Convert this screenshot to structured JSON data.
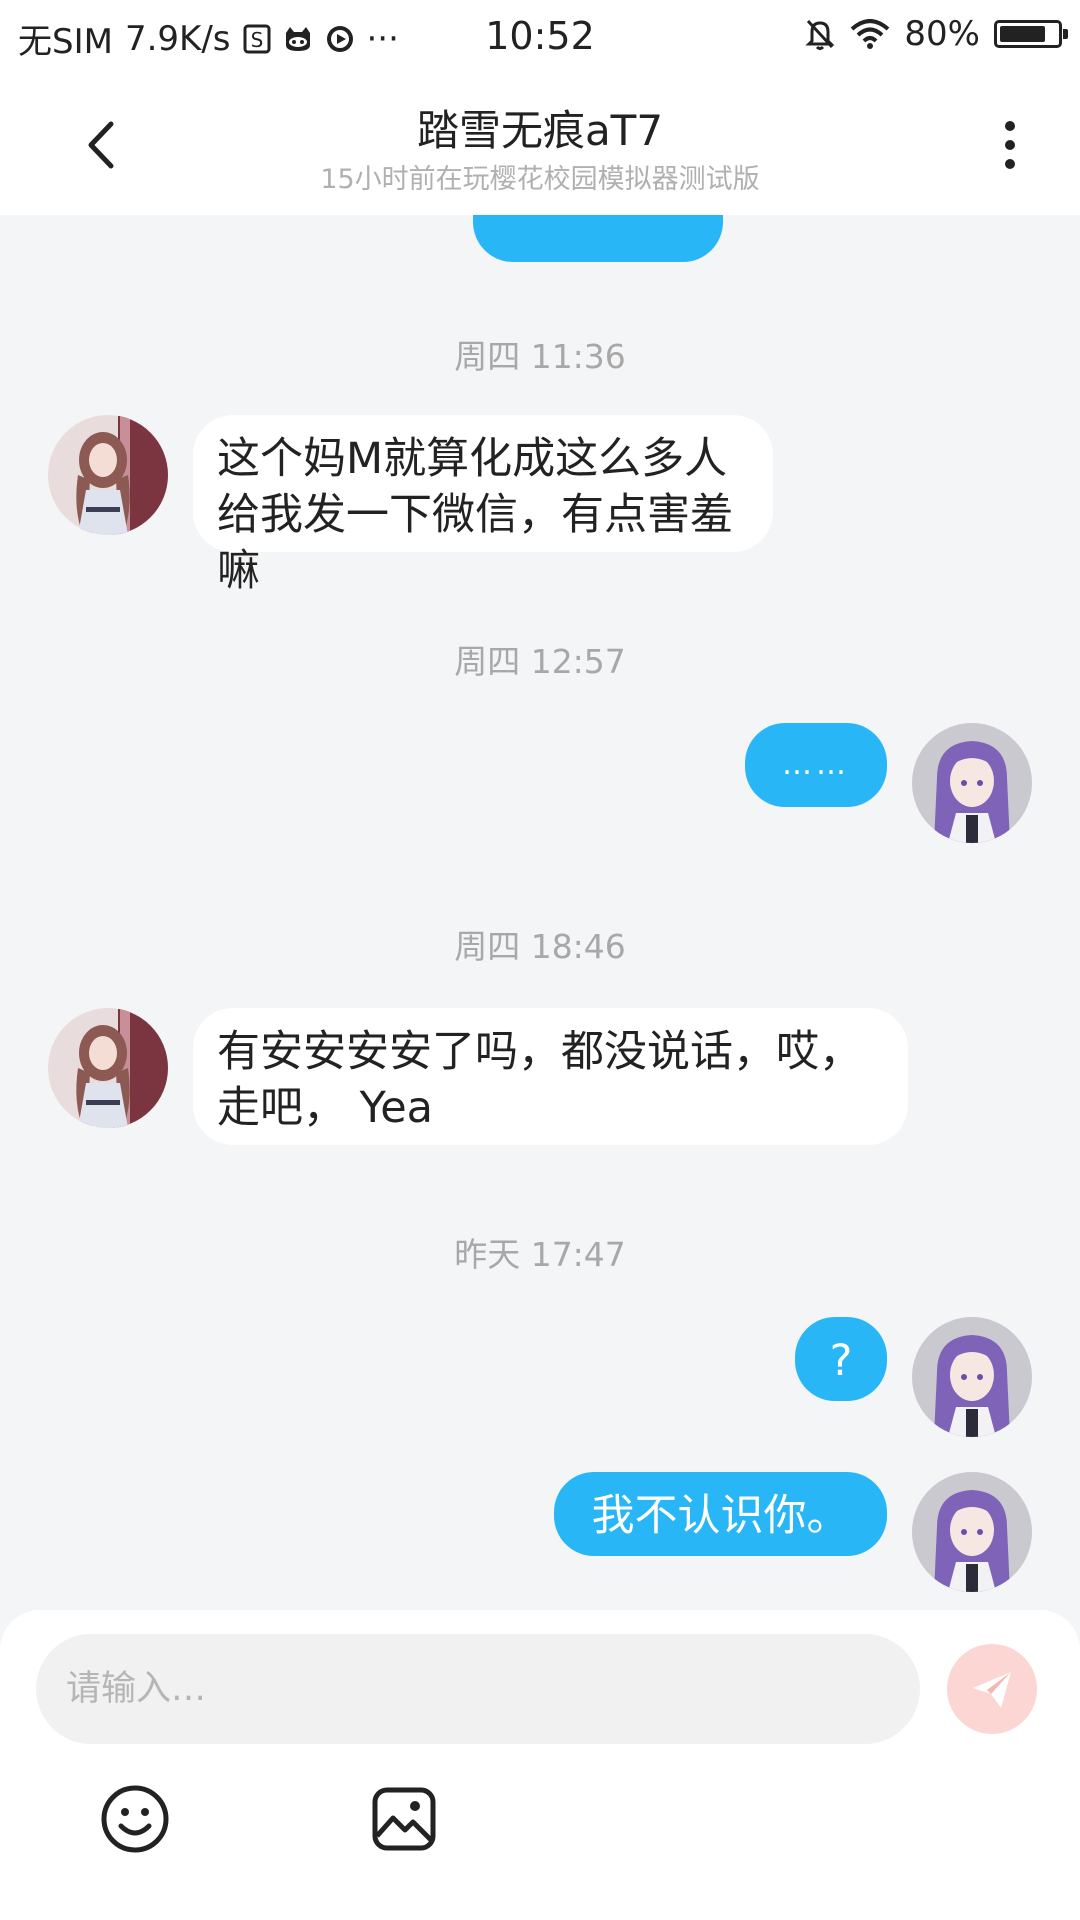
{
  "status_bar": {
    "carrier": "无SIM",
    "net_speed": "7.9K/s",
    "icons": [
      "s-box-icon",
      "cat-icon",
      "play-icon"
    ],
    "overflow": "···",
    "time": "10:52",
    "battery_percent": "80%",
    "battery_level": 0.8
  },
  "header": {
    "title": "踏雪无痕aT7",
    "subtitle": "15小时前在玩樱花校园模拟器测试版"
  },
  "messages": [
    {
      "type": "timestamp",
      "text": "周四 11:36"
    },
    {
      "type": "in",
      "text": "这个妈M就算化成这么多人给我发一下微信，有点害羞嘛"
    },
    {
      "type": "timestamp",
      "text": "周四 12:57"
    },
    {
      "type": "out",
      "text": "……"
    },
    {
      "type": "timestamp",
      "text": "周四 18:46"
    },
    {
      "type": "in",
      "text": "有安安安安了吗，都没说话，哎，走吧， Yea"
    },
    {
      "type": "timestamp",
      "text": "昨天 17:47"
    },
    {
      "type": "out",
      "text": "?"
    },
    {
      "type": "out",
      "text": "我不认识你。"
    }
  ],
  "composer": {
    "placeholder": "请输入…",
    "tools": [
      "emoji-icon",
      "image-icon"
    ]
  },
  "colors": {
    "accent": "#29b6f6",
    "background": "#f4f5f7",
    "send_button": "#fbd6d3"
  }
}
